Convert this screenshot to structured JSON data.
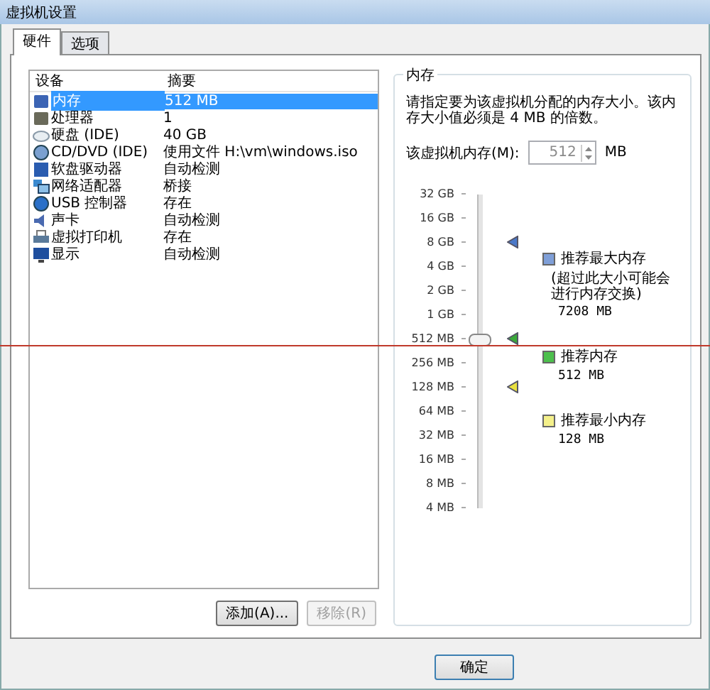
{
  "window": {
    "title": "虚拟机设置"
  },
  "tabs": [
    {
      "label": "硬件",
      "selected": true
    },
    {
      "label": "选项",
      "selected": false
    }
  ],
  "devices": {
    "columns": [
      "设备",
      "摘要"
    ],
    "rows": [
      {
        "kind": "memory",
        "name": "内存",
        "summary": "512 MB",
        "selected": true
      },
      {
        "kind": "cpu",
        "name": "处理器",
        "summary": "1",
        "selected": false
      },
      {
        "kind": "disk",
        "name": "硬盘 (IDE)",
        "summary": "40 GB",
        "selected": false
      },
      {
        "kind": "cdrom",
        "name": "CD/DVD (IDE)",
        "summary": "使用文件 H:\\vm\\windows.iso",
        "selected": false
      },
      {
        "kind": "floppy",
        "name": "软盘驱动器",
        "summary": "自动检测",
        "selected": false
      },
      {
        "kind": "network",
        "name": "网络适配器",
        "summary": "桥接",
        "selected": false
      },
      {
        "kind": "usb",
        "name": "USB 控制器",
        "summary": "存在",
        "selected": false
      },
      {
        "kind": "sound",
        "name": "声卡",
        "summary": "自动检测",
        "selected": false
      },
      {
        "kind": "printer",
        "name": "虚拟打印机",
        "summary": "存在",
        "selected": false
      },
      {
        "kind": "display",
        "name": "显示",
        "summary": "自动检测",
        "selected": false
      }
    ],
    "buttons": [
      {
        "label": "添加(A)...",
        "disabled": false
      },
      {
        "label": "移除(R)",
        "disabled": true
      }
    ]
  },
  "memory": {
    "legend": "内存",
    "description": "请指定要为该虚拟机分配的内存大小。该内存大小值必须是 4 MB 的倍数。",
    "field_label": "该虚拟机内存(M):",
    "value": "512",
    "unit": "MB",
    "scale": [
      "32 GB",
      "16 GB",
      "8 GB",
      "4 GB",
      "2 GB",
      "1 GB",
      "512 MB",
      "256 MB",
      "128 MB",
      "64 MB",
      "32 MB",
      "16 MB",
      "8 MB",
      "4 MB"
    ],
    "slider": {
      "level": 0.538
    },
    "markers": [
      {
        "level": 0.846,
        "color": "#4a78c8"
      },
      {
        "level": 0.538,
        "color": "#3aa83a"
      },
      {
        "level": 0.385,
        "color": "#e8e040"
      }
    ],
    "recommendations": [
      {
        "title": "推荐最大内存",
        "note": "(超过此大小可能会进行内存交换)",
        "value": "7208 MB",
        "color": "#7f9fd8"
      },
      {
        "title": "推荐内存",
        "value": "512 MB",
        "color": "#4cc04c"
      },
      {
        "title": "推荐最小内存",
        "value": "128 MB",
        "color": "#f4f08a"
      }
    ]
  },
  "footer": {
    "buttons": [
      "确定"
    ]
  }
}
